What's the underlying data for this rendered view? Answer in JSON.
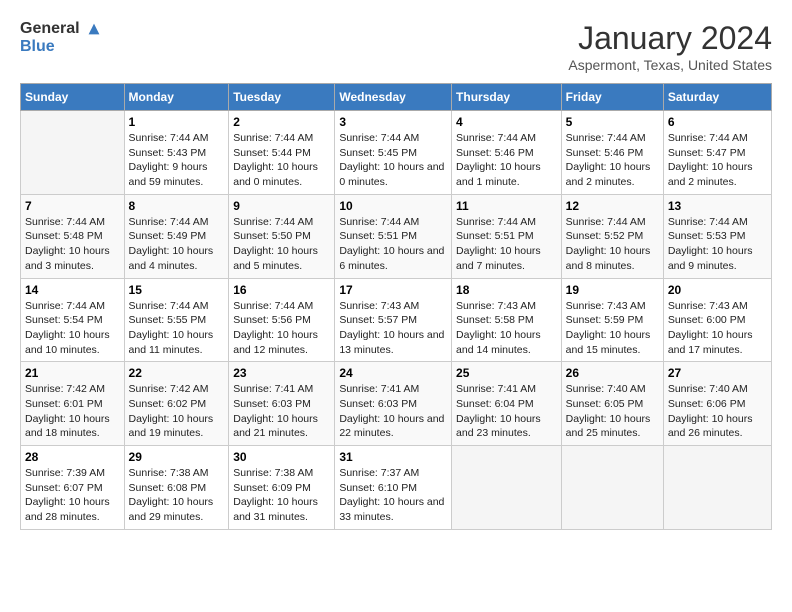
{
  "header": {
    "logo_line1": "General",
    "logo_line2": "Blue",
    "month_title": "January 2024",
    "location": "Aspermont, Texas, United States"
  },
  "weekdays": [
    "Sunday",
    "Monday",
    "Tuesday",
    "Wednesday",
    "Thursday",
    "Friday",
    "Saturday"
  ],
  "weeks": [
    [
      {
        "day": "",
        "sunrise": "",
        "sunset": "",
        "daylight": ""
      },
      {
        "day": "1",
        "sunrise": "Sunrise: 7:44 AM",
        "sunset": "Sunset: 5:43 PM",
        "daylight": "Daylight: 9 hours and 59 minutes."
      },
      {
        "day": "2",
        "sunrise": "Sunrise: 7:44 AM",
        "sunset": "Sunset: 5:44 PM",
        "daylight": "Daylight: 10 hours and 0 minutes."
      },
      {
        "day": "3",
        "sunrise": "Sunrise: 7:44 AM",
        "sunset": "Sunset: 5:45 PM",
        "daylight": "Daylight: 10 hours and 0 minutes."
      },
      {
        "day": "4",
        "sunrise": "Sunrise: 7:44 AM",
        "sunset": "Sunset: 5:46 PM",
        "daylight": "Daylight: 10 hours and 1 minute."
      },
      {
        "day": "5",
        "sunrise": "Sunrise: 7:44 AM",
        "sunset": "Sunset: 5:46 PM",
        "daylight": "Daylight: 10 hours and 2 minutes."
      },
      {
        "day": "6",
        "sunrise": "Sunrise: 7:44 AM",
        "sunset": "Sunset: 5:47 PM",
        "daylight": "Daylight: 10 hours and 2 minutes."
      }
    ],
    [
      {
        "day": "7",
        "sunrise": "Sunrise: 7:44 AM",
        "sunset": "Sunset: 5:48 PM",
        "daylight": "Daylight: 10 hours and 3 minutes."
      },
      {
        "day": "8",
        "sunrise": "Sunrise: 7:44 AM",
        "sunset": "Sunset: 5:49 PM",
        "daylight": "Daylight: 10 hours and 4 minutes."
      },
      {
        "day": "9",
        "sunrise": "Sunrise: 7:44 AM",
        "sunset": "Sunset: 5:50 PM",
        "daylight": "Daylight: 10 hours and 5 minutes."
      },
      {
        "day": "10",
        "sunrise": "Sunrise: 7:44 AM",
        "sunset": "Sunset: 5:51 PM",
        "daylight": "Daylight: 10 hours and 6 minutes."
      },
      {
        "day": "11",
        "sunrise": "Sunrise: 7:44 AM",
        "sunset": "Sunset: 5:51 PM",
        "daylight": "Daylight: 10 hours and 7 minutes."
      },
      {
        "day": "12",
        "sunrise": "Sunrise: 7:44 AM",
        "sunset": "Sunset: 5:52 PM",
        "daylight": "Daylight: 10 hours and 8 minutes."
      },
      {
        "day": "13",
        "sunrise": "Sunrise: 7:44 AM",
        "sunset": "Sunset: 5:53 PM",
        "daylight": "Daylight: 10 hours and 9 minutes."
      }
    ],
    [
      {
        "day": "14",
        "sunrise": "Sunrise: 7:44 AM",
        "sunset": "Sunset: 5:54 PM",
        "daylight": "Daylight: 10 hours and 10 minutes."
      },
      {
        "day": "15",
        "sunrise": "Sunrise: 7:44 AM",
        "sunset": "Sunset: 5:55 PM",
        "daylight": "Daylight: 10 hours and 11 minutes."
      },
      {
        "day": "16",
        "sunrise": "Sunrise: 7:44 AM",
        "sunset": "Sunset: 5:56 PM",
        "daylight": "Daylight: 10 hours and 12 minutes."
      },
      {
        "day": "17",
        "sunrise": "Sunrise: 7:43 AM",
        "sunset": "Sunset: 5:57 PM",
        "daylight": "Daylight: 10 hours and 13 minutes."
      },
      {
        "day": "18",
        "sunrise": "Sunrise: 7:43 AM",
        "sunset": "Sunset: 5:58 PM",
        "daylight": "Daylight: 10 hours and 14 minutes."
      },
      {
        "day": "19",
        "sunrise": "Sunrise: 7:43 AM",
        "sunset": "Sunset: 5:59 PM",
        "daylight": "Daylight: 10 hours and 15 minutes."
      },
      {
        "day": "20",
        "sunrise": "Sunrise: 7:43 AM",
        "sunset": "Sunset: 6:00 PM",
        "daylight": "Daylight: 10 hours and 17 minutes."
      }
    ],
    [
      {
        "day": "21",
        "sunrise": "Sunrise: 7:42 AM",
        "sunset": "Sunset: 6:01 PM",
        "daylight": "Daylight: 10 hours and 18 minutes."
      },
      {
        "day": "22",
        "sunrise": "Sunrise: 7:42 AM",
        "sunset": "Sunset: 6:02 PM",
        "daylight": "Daylight: 10 hours and 19 minutes."
      },
      {
        "day": "23",
        "sunrise": "Sunrise: 7:41 AM",
        "sunset": "Sunset: 6:03 PM",
        "daylight": "Daylight: 10 hours and 21 minutes."
      },
      {
        "day": "24",
        "sunrise": "Sunrise: 7:41 AM",
        "sunset": "Sunset: 6:03 PM",
        "daylight": "Daylight: 10 hours and 22 minutes."
      },
      {
        "day": "25",
        "sunrise": "Sunrise: 7:41 AM",
        "sunset": "Sunset: 6:04 PM",
        "daylight": "Daylight: 10 hours and 23 minutes."
      },
      {
        "day": "26",
        "sunrise": "Sunrise: 7:40 AM",
        "sunset": "Sunset: 6:05 PM",
        "daylight": "Daylight: 10 hours and 25 minutes."
      },
      {
        "day": "27",
        "sunrise": "Sunrise: 7:40 AM",
        "sunset": "Sunset: 6:06 PM",
        "daylight": "Daylight: 10 hours and 26 minutes."
      }
    ],
    [
      {
        "day": "28",
        "sunrise": "Sunrise: 7:39 AM",
        "sunset": "Sunset: 6:07 PM",
        "daylight": "Daylight: 10 hours and 28 minutes."
      },
      {
        "day": "29",
        "sunrise": "Sunrise: 7:38 AM",
        "sunset": "Sunset: 6:08 PM",
        "daylight": "Daylight: 10 hours and 29 minutes."
      },
      {
        "day": "30",
        "sunrise": "Sunrise: 7:38 AM",
        "sunset": "Sunset: 6:09 PM",
        "daylight": "Daylight: 10 hours and 31 minutes."
      },
      {
        "day": "31",
        "sunrise": "Sunrise: 7:37 AM",
        "sunset": "Sunset: 6:10 PM",
        "daylight": "Daylight: 10 hours and 33 minutes."
      },
      {
        "day": "",
        "sunrise": "",
        "sunset": "",
        "daylight": ""
      },
      {
        "day": "",
        "sunrise": "",
        "sunset": "",
        "daylight": ""
      },
      {
        "day": "",
        "sunrise": "",
        "sunset": "",
        "daylight": ""
      }
    ]
  ]
}
